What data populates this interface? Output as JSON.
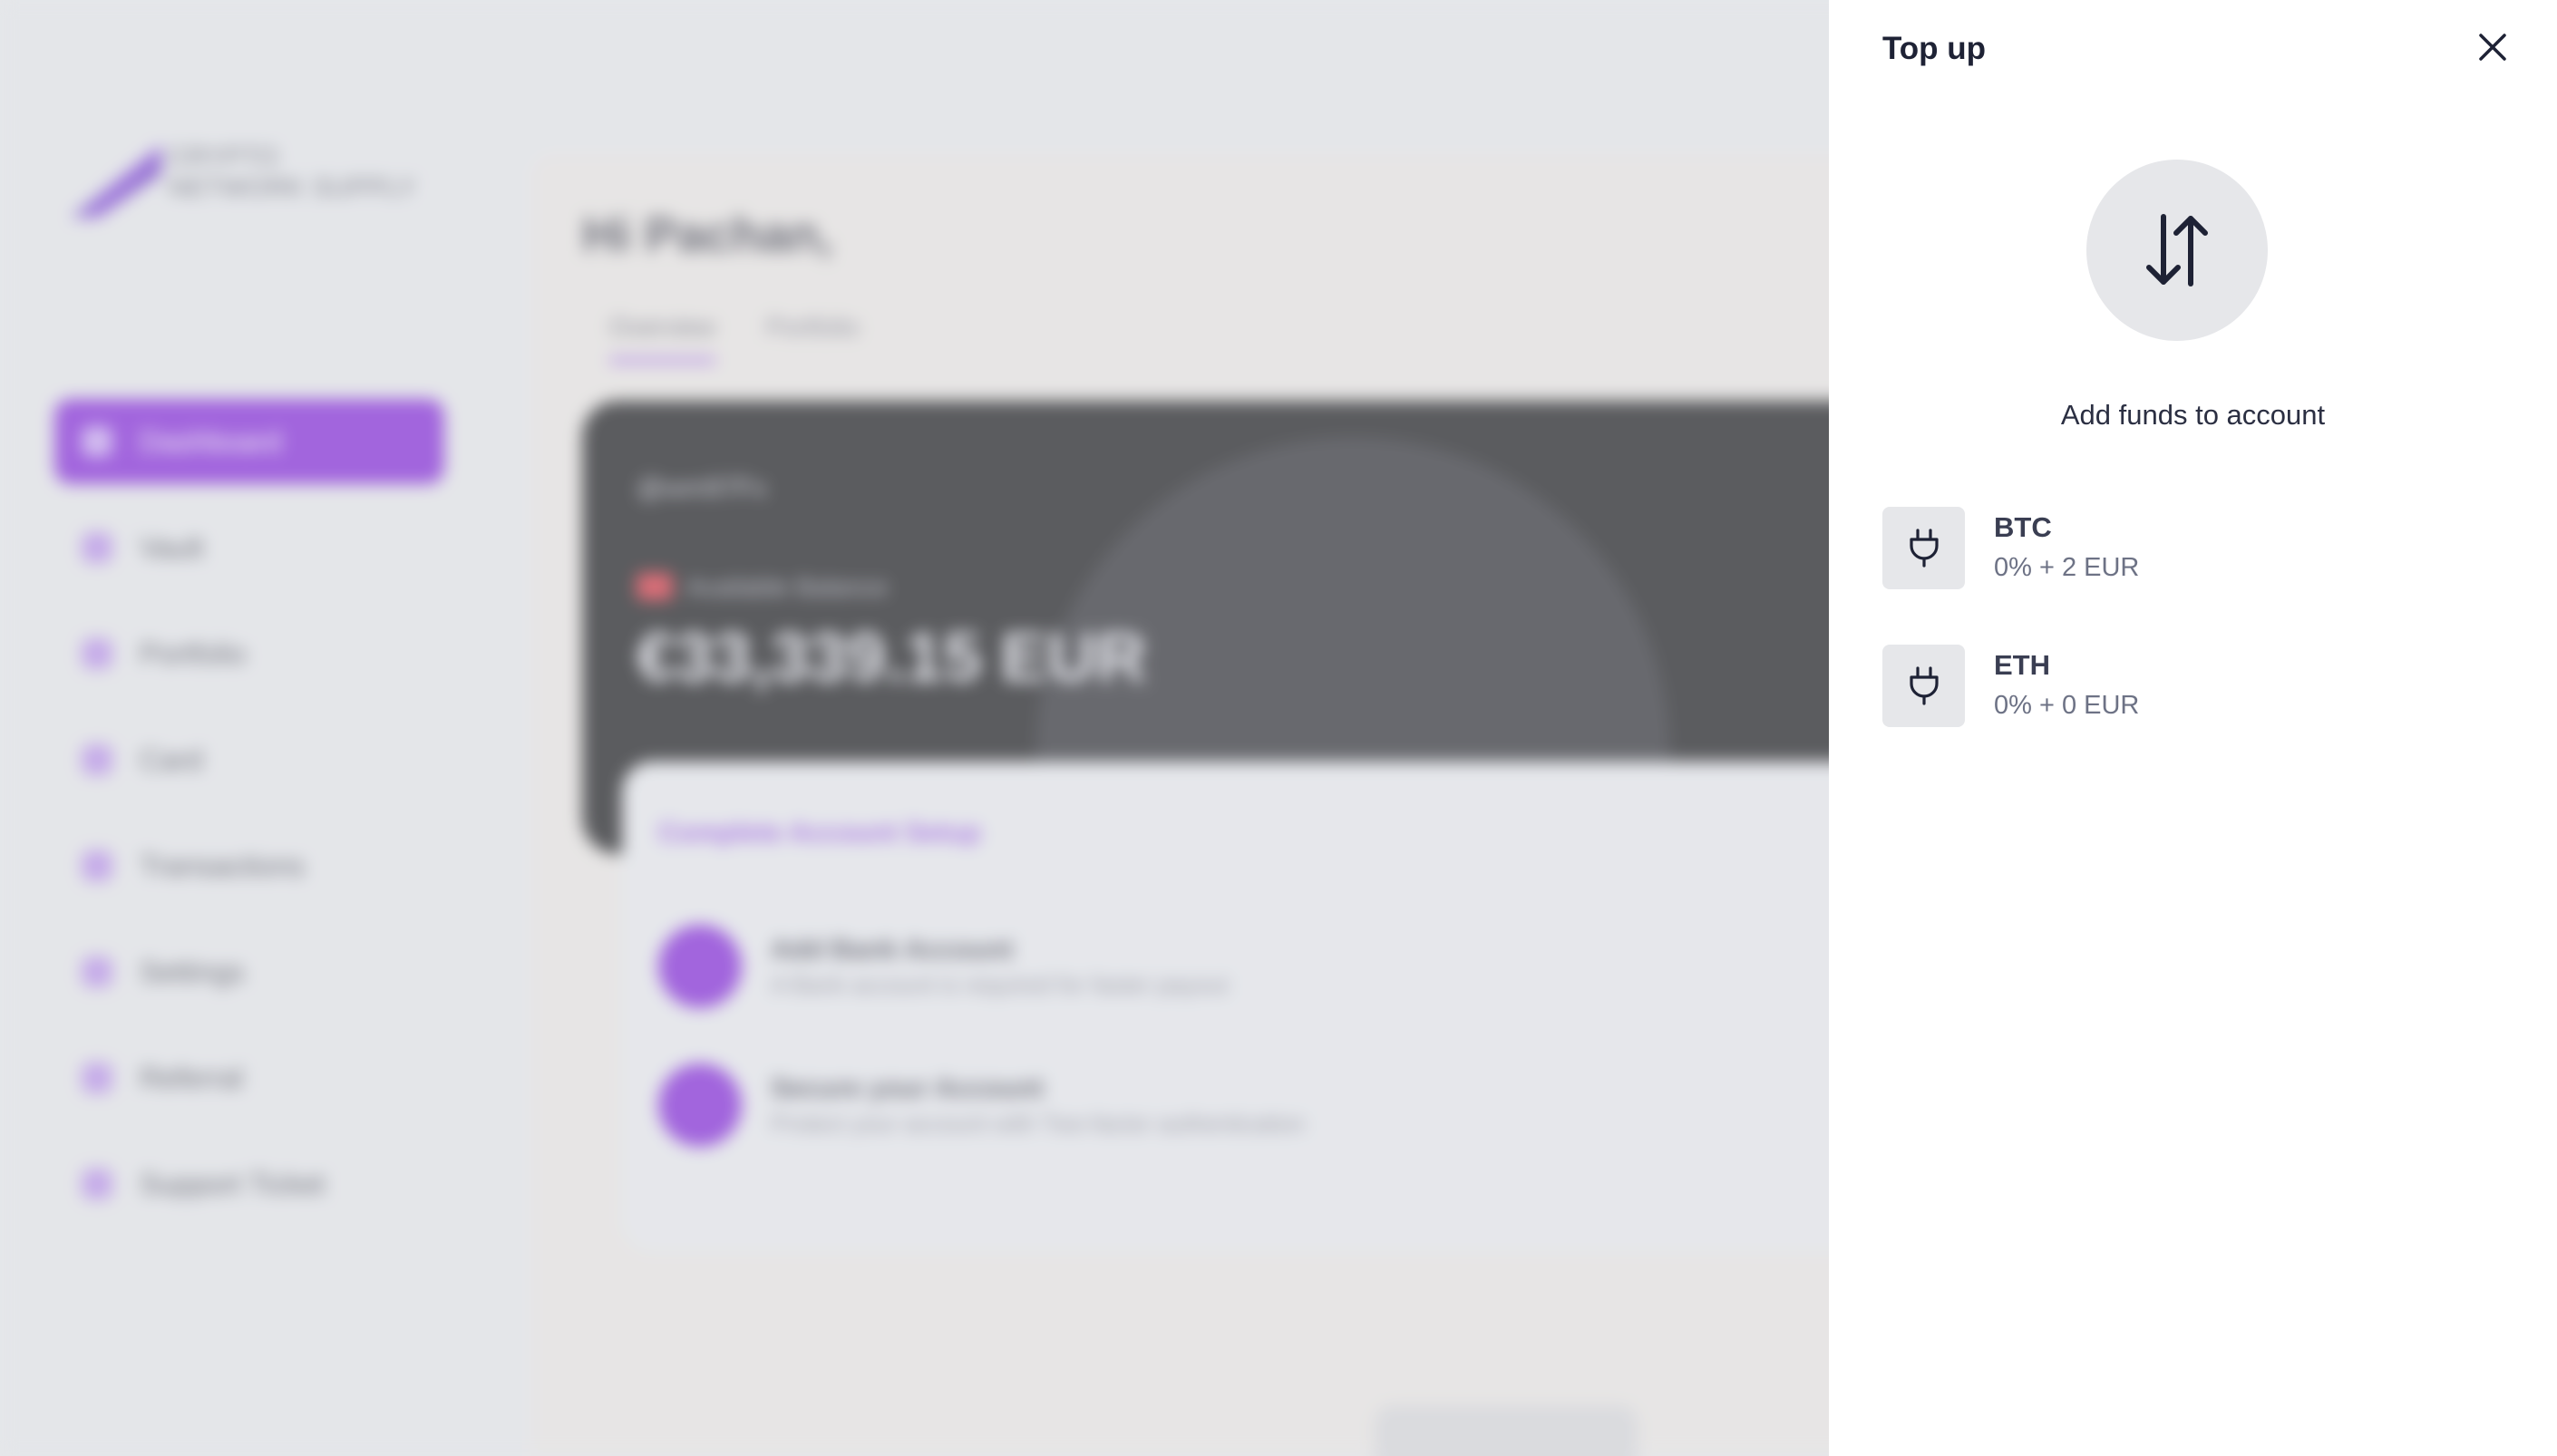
{
  "background": {
    "logo": {
      "text": "CRYPTO NETWORK SUPPLY"
    },
    "sidebar": {
      "items": [
        {
          "label": "Dashboard",
          "active": true
        },
        {
          "label": "Vault"
        },
        {
          "label": "Portfolio"
        },
        {
          "label": "Card"
        },
        {
          "label": "Transactions"
        },
        {
          "label": "Settings"
        },
        {
          "label": "Referral"
        },
        {
          "label": "Support Ticket"
        }
      ]
    },
    "main": {
      "greeting": "Hi Pachan,",
      "tabs": [
        {
          "label": "Overview",
          "active": true
        },
        {
          "label": "Portfolio"
        }
      ],
      "balance_card": {
        "wallet_id": "@wm97Fx",
        "balance_label": "Available Balance",
        "balance_amount": "€33,339.15 EUR"
      },
      "setup_card": {
        "title": "Complete Account Setup",
        "steps": [
          {
            "title": "Add Bank Account",
            "subtitle": "A Bank account is required for faster payout"
          },
          {
            "title": "Secure your Account",
            "subtitle": "Protect your account with Two-factor authentication"
          }
        ]
      }
    }
  },
  "panel": {
    "title": "Top up",
    "close_icon": "close-icon",
    "hero_icon": "transfer-arrows-icon",
    "caption": "Add funds to account",
    "options": [
      {
        "name": "BTC",
        "fee": "0% + 2 EUR",
        "icon": "plug-icon"
      },
      {
        "name": "ETH",
        "fee": "0% + 0 EUR",
        "icon": "plug-icon"
      }
    ]
  },
  "colors": {
    "accent_purple": "#7e1fd6",
    "panel_bg": "#ffffff",
    "icon_tile_bg": "#e6e7ea",
    "title_text": "#1e2235"
  }
}
